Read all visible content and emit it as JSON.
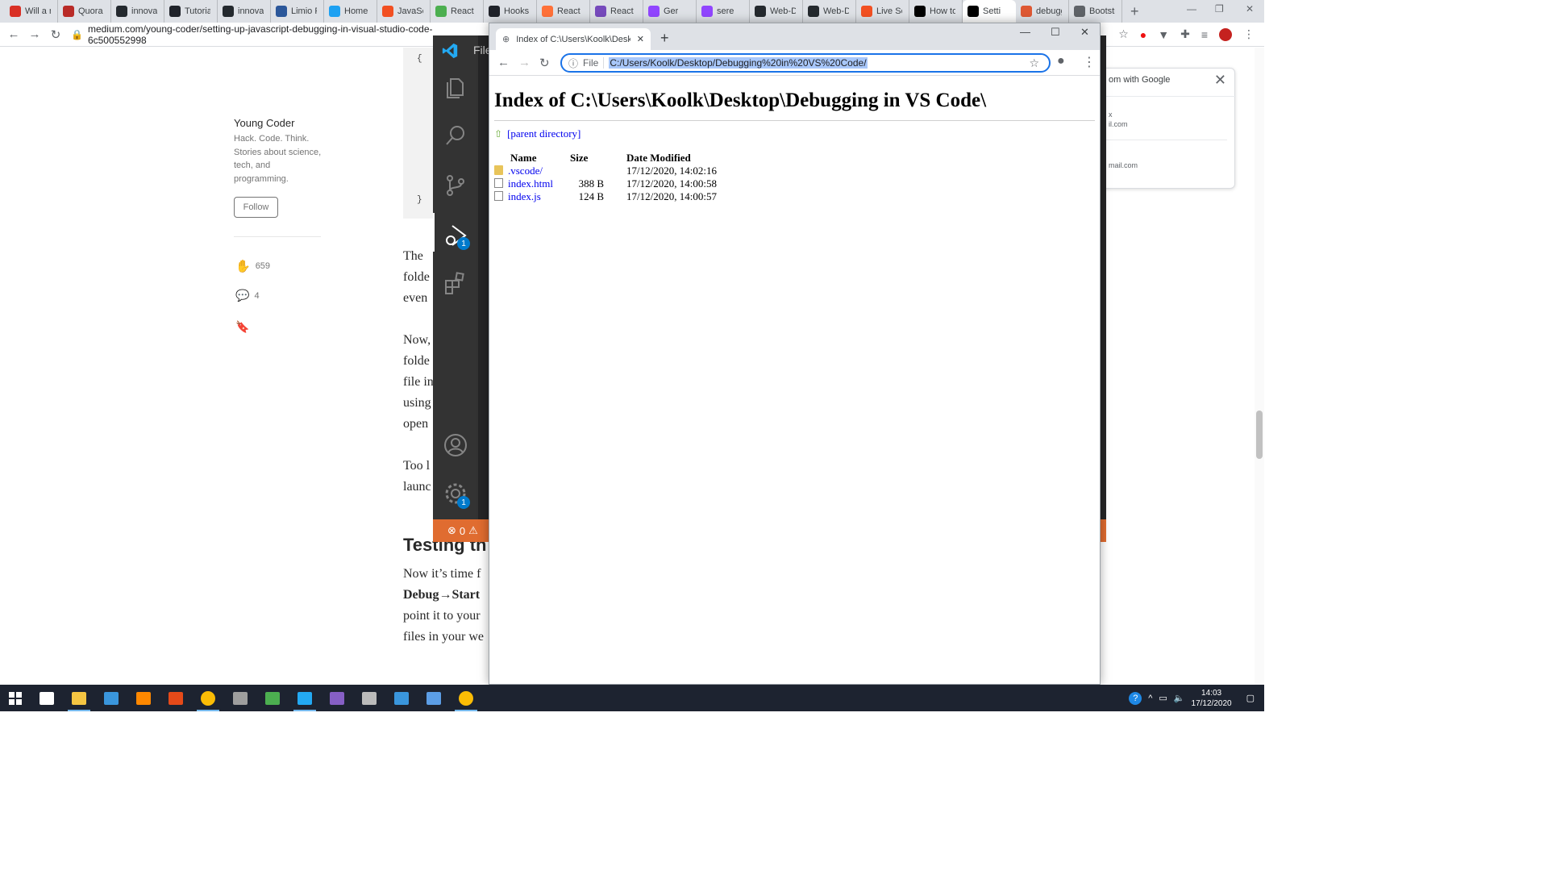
{
  "back_browser": {
    "tabs": [
      {
        "label": "Will a n",
        "icon": "gmail-icon",
        "color": "#d93025"
      },
      {
        "label": "Quora",
        "icon": "quora-icon",
        "color": "#b92b27"
      },
      {
        "label": "innovat",
        "icon": "github-icon",
        "color": "#24292e"
      },
      {
        "label": "Tutorial",
        "icon": "react-icon",
        "color": "#20232a"
      },
      {
        "label": "innovat",
        "icon": "github-icon",
        "color": "#24292e"
      },
      {
        "label": "Limio P",
        "icon": "word-icon",
        "color": "#2b579a"
      },
      {
        "label": "Home /",
        "icon": "twitter-icon",
        "color": "#1da1f2"
      },
      {
        "label": "JavaScr",
        "icon": "windows-icon",
        "color": "#f25022"
      },
      {
        "label": "React C",
        "icon": "image-icon",
        "color": "#4caf50"
      },
      {
        "label": "Hooks",
        "icon": "react-icon",
        "color": "#20232a"
      },
      {
        "label": "React R",
        "icon": "firefox-icon",
        "color": "#ff7139"
      },
      {
        "label": "React R",
        "icon": "fluent-icon",
        "color": "#764abc"
      },
      {
        "label": "Ger",
        "icon": "twitch-icon",
        "color": "#9146ff"
      },
      {
        "label": "sere",
        "icon": "twitch-icon",
        "color": "#9146ff"
      },
      {
        "label": "Web-D",
        "icon": "github-icon",
        "color": "#24292e"
      },
      {
        "label": "Web-D",
        "icon": "github-icon",
        "color": "#24292e"
      },
      {
        "label": "Live Se",
        "icon": "windows-icon",
        "color": "#f25022"
      },
      {
        "label": "How to",
        "icon": "r-icon",
        "color": "#000000"
      },
      {
        "label": "Setti",
        "icon": "medium-icon",
        "color": "#000000"
      },
      {
        "label": "debugg",
        "icon": "duckduckgo-icon",
        "color": "#de5833"
      },
      {
        "label": "Bootstr",
        "icon": "globe-icon",
        "color": "#5f6368"
      }
    ],
    "url": "medium.com/young-coder/setting-up-javascript-debugging-in-visual-studio-code-6c500552998"
  },
  "medium": {
    "author_name": "Young Coder",
    "author_bio": "Hack. Code. Think. Stories about science, tech, and programming.",
    "follow_label": "Follow",
    "claps": "659",
    "comments": "4",
    "code_open": "{",
    "code_close": "}",
    "prose_lines": [
      "The",
      "folde",
      "even",
      "",
      "Now,",
      "folde",
      "file in",
      "using",
      "open",
      "",
      "Too l",
      "launc"
    ],
    "heading": "Testing th",
    "prose_lines_2": [
      "Now it’s time f",
      "Debug→Start",
      "point it to your",
      "files in your we"
    ]
  },
  "google_popup": {
    "title": "om with Google",
    "account1_name": "x",
    "account1_email": "il.com",
    "account2_email": "mail.com"
  },
  "vscode": {
    "menu_label": "File",
    "debug_badge": "1",
    "settings_badge": "1",
    "status_errors": "0"
  },
  "front_window": {
    "tab_title": "Index of C:\\Users\\Koolk\\Desktop",
    "scheme_label": "File",
    "url": "C:/Users/Koolk/Desktop/Debugging%20in%20VS%20Code/",
    "heading": "Index of C:\\Users\\Koolk\\Desktop\\Debugging in VS Code\\",
    "parent_link": "[parent directory]",
    "columns": [
      "Name",
      "Size",
      "Date Modified"
    ],
    "rows": [
      {
        "name": ".vscode/",
        "size": "",
        "date": "17/12/2020, 14:02:16",
        "type": "folder"
      },
      {
        "name": "index.html",
        "size": "388 B",
        "date": "17/12/2020, 14:00:58",
        "type": "file"
      },
      {
        "name": "index.js",
        "size": "124 B",
        "date": "17/12/2020, 14:00:57",
        "type": "file"
      }
    ]
  },
  "taskbar": {
    "time": "14:03",
    "date": "17/12/2020",
    "apps": [
      {
        "icon": "task-view-icon",
        "color": "#ffffff"
      },
      {
        "icon": "file-explorer-icon",
        "color": "#f5c542"
      },
      {
        "icon": "store-icon",
        "color": "#3a96dd"
      },
      {
        "icon": "vlc-icon",
        "color": "#ff8800"
      },
      {
        "icon": "office-icon",
        "color": "#e64a19"
      },
      {
        "icon": "chrome-icon",
        "color": "#fbbc05"
      },
      {
        "icon": "game-icon",
        "color": "#9e9e9e"
      },
      {
        "icon": "maps-icon",
        "color": "#4caf50"
      },
      {
        "icon": "vscode-icon",
        "color": "#23a9f2"
      },
      {
        "icon": "visual-studio-icon",
        "color": "#865fc5"
      },
      {
        "icon": "app-icon",
        "color": "#bbbbbb"
      },
      {
        "icon": "window-icon",
        "color": "#3a96dd"
      },
      {
        "icon": "dev-icon",
        "color": "#5c9ee6"
      },
      {
        "icon": "chrome-icon",
        "color": "#fbbc05"
      }
    ]
  }
}
